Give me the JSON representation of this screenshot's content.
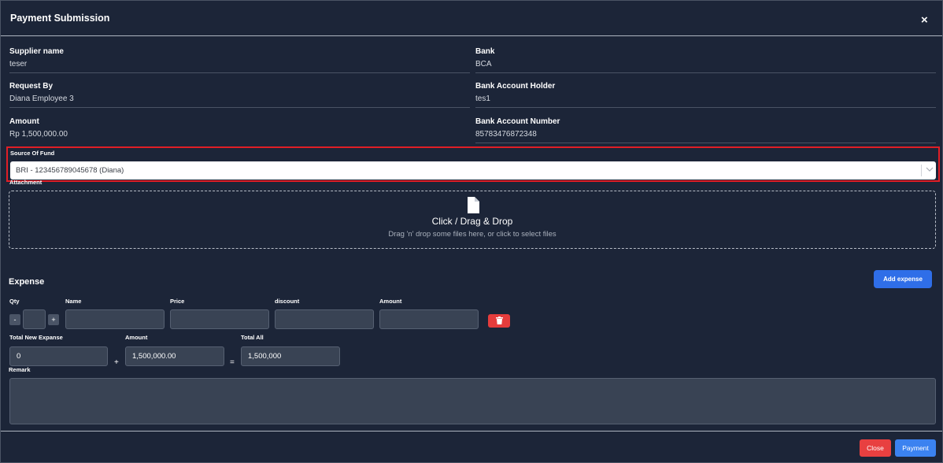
{
  "modal": {
    "title": "Payment Submission",
    "close_icon": "×"
  },
  "details": {
    "supplier": {
      "label": "Supplier name",
      "value": "teser"
    },
    "bank": {
      "label": "Bank",
      "value": "BCA"
    },
    "request_by": {
      "label": "Request By",
      "value": "Diana Employee 3"
    },
    "account_holder": {
      "label": "Bank Account Holder",
      "value": "tes1"
    },
    "amount": {
      "label": "Amount",
      "value": "Rp 1,500,000.00"
    },
    "account_number": {
      "label": "Bank Account Number",
      "value": "85783476872348"
    }
  },
  "source_of_fund": {
    "label": "Source Of Fund",
    "selected": "BRI - 123456789045678 (Diana)",
    "chevron_icon": "chevron-down-icon"
  },
  "attachment": {
    "label": "Attachment",
    "title": "Click / Drag & Drop",
    "subtitle": "Drag 'n' drop some files here, or click to select files",
    "icon": "file-icon"
  },
  "expense": {
    "title": "Expense",
    "add_label": "Add expense",
    "columns": {
      "qty": "Qty",
      "name": "Name",
      "price": "Price",
      "discount": "discount",
      "amount": "Amount"
    },
    "row": {
      "minus": "-",
      "plus": "+",
      "qty": "",
      "name": "",
      "price": "",
      "discount": "",
      "amount": ""
    },
    "delete_icon": "trash-icon"
  },
  "totals": {
    "new_expense_label": "Total New Expanse",
    "new_expense_value": "0",
    "plus": "+",
    "amount_label": "Amount",
    "amount_value": "1,500,000.00",
    "equals": "=",
    "total_label": "Total All",
    "total_value": "1,500,000"
  },
  "remark": {
    "label": "Remark",
    "value": ""
  },
  "footer": {
    "close_label": "Close",
    "payment_label": "Payment"
  },
  "colors": {
    "background": "#1c2538",
    "primary": "#2f6ee8",
    "danger": "#e53c3c",
    "highlight": "#e01e26"
  }
}
